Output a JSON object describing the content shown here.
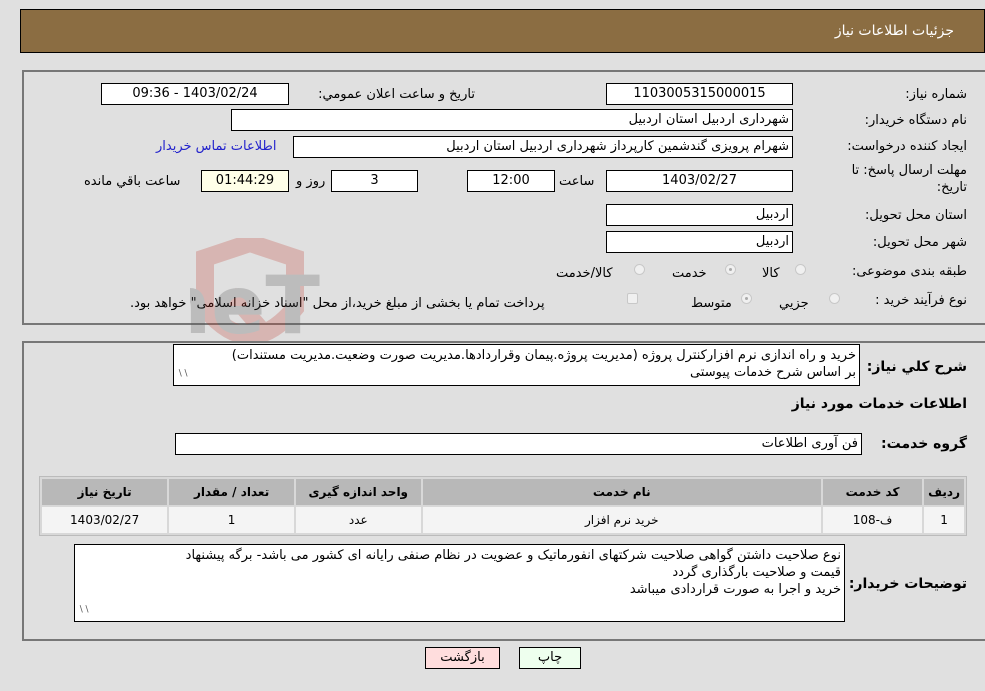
{
  "header": {
    "title": "جزئیات اطلاعات نیاز"
  },
  "form": {
    "need_number": {
      "label": "شماره نیاز:",
      "value": "1103005315000015"
    },
    "announce_datetime": {
      "label": "تاریخ و ساعت اعلان عمومي:",
      "value": "1403/02/24 - 09:36"
    },
    "buyer_org": {
      "label": "نام دستگاه خریدار:",
      "value": "شهرداری اردبیل استان اردبیل"
    },
    "requester": {
      "label": "ایجاد کننده درخواست:",
      "value": "شهرام پرویزی گندشمین کارپرداز شهرداری اردبیل استان اردبیل"
    },
    "contact_link": "اطلاعات تماس خریدار",
    "deadline": {
      "label_line1": "مهلت ارسال پاسخ: تا",
      "label_line2": "تاریخ:",
      "date": "1403/02/27",
      "time_label": "ساعت",
      "time": "12:00",
      "days": "3",
      "days_label": "روز و",
      "remaining": "01:44:29",
      "remaining_label": "ساعت باقي مانده"
    },
    "delivery_province": {
      "label": "استان محل تحویل:",
      "value": "اردبیل"
    },
    "delivery_city": {
      "label": "شهر محل تحویل:",
      "value": "اردبیل"
    },
    "category": {
      "label": "طبقه بندی موضوعی:",
      "options": [
        "کالا",
        "خدمت",
        "کالا/خدمت"
      ],
      "selected": "خدمت"
    },
    "purchase_type": {
      "label": "نوع فرآیند خرید :",
      "options": [
        "جزيي",
        "متوسط"
      ],
      "selected": "متوسط",
      "treasury_note": "پرداخت تمام یا بخشی از مبلغ خرید،از محل \"اسناد خزانه اسلامی\" خواهد بود."
    }
  },
  "details": {
    "summary_label": "شرح کلي نياز:",
    "summary_line1": "خرید و راه اندازی نرم افزارکنترل پروژه (مدیریت پروژه.پیمان وقراردادها.مدیریت صورت وضعیت.مدیریت مستندات)",
    "summary_line2": "بر اساس شرح خدمات پیوستی",
    "services_title": "اطلاعات خدمات مورد نیاز",
    "service_group_label": "گروه خدمت:",
    "service_group_value": "فن آوری اطلاعات",
    "table": {
      "headers": [
        "ردیف",
        "کد خدمت",
        "نام خدمت",
        "واحد اندازه گیری",
        "تعداد / مقدار",
        "تاریخ نیاز"
      ],
      "rows": [
        [
          "1",
          "ف-108",
          "خرید نرم افزار",
          "عدد",
          "1",
          "1403/02/27"
        ]
      ]
    },
    "buyer_notes_label": "توضیحات خریدار:",
    "buyer_notes_line1": "نوع صلاحیت داشتن گواهی صلاحیت شرکتهای انفورماتیک و عضویت در نظام صنفی رایانه ای کشور می باشد- برگه پیشنهاد",
    "buyer_notes_line2": "قیمت و صلاحیت بارگذاری گردد",
    "buyer_notes_line3": "خرید و اجرا به صورت قراردادی میباشد"
  },
  "buttons": {
    "print": "چاپ",
    "back": "بازگشت"
  },
  "colors": {
    "header_bg": "#8b6d42",
    "print_bg": "#eeffee",
    "back_bg": "#ffdddd",
    "link": "#2222cc"
  }
}
